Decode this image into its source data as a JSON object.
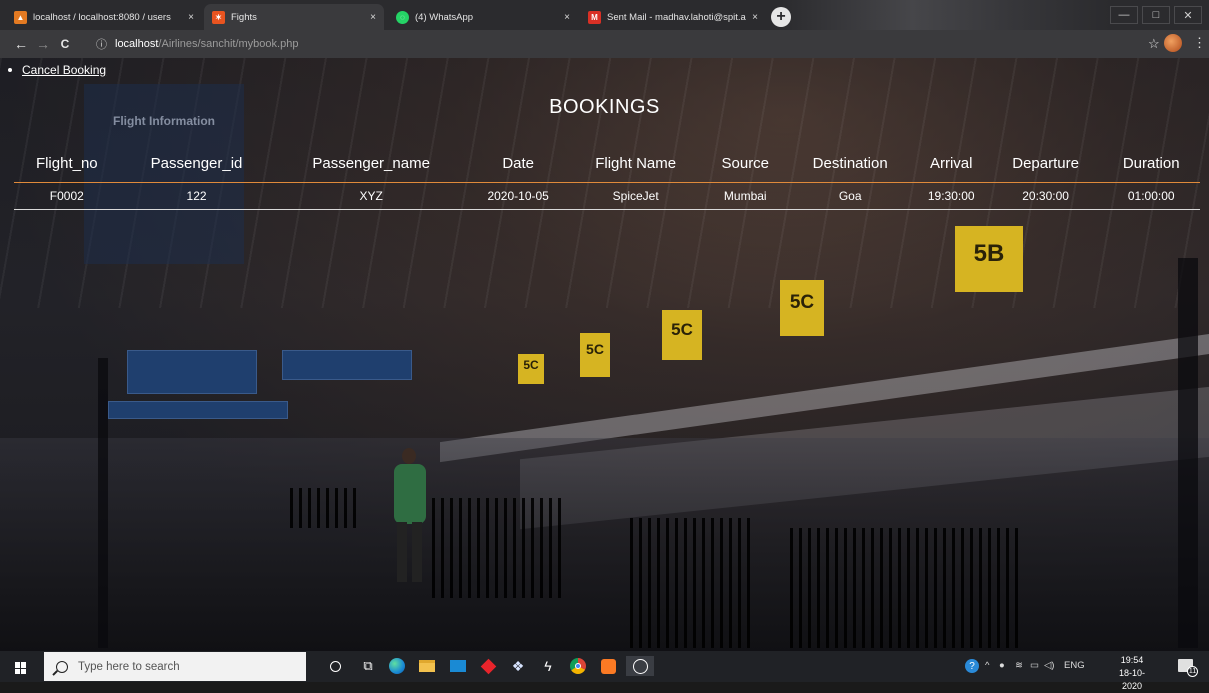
{
  "browser": {
    "tabs": [
      {
        "title": "localhost / localhost:8080 / users",
        "favicon_color": "#e37a22",
        "active": false
      },
      {
        "title": "Fights",
        "favicon_color": "#e95420",
        "active": true
      },
      {
        "title": "(4) WhatsApp",
        "favicon_color": "#25d366",
        "active": false
      },
      {
        "title": "Sent Mail - madhav.lahoti@spit.ac",
        "favicon_color": "#d93025",
        "active": false
      }
    ],
    "new_tab_symbol": "+",
    "url_host": "localhost",
    "url_path": "/Airlines/sanchit/mybook.php",
    "back_symbol": "←",
    "forward_symbol": "→",
    "reload_symbol": "C",
    "info_symbol": "ⓘ",
    "close_symbol": "×",
    "star_symbol": "☆",
    "menu_symbol": "⋮",
    "minimize_symbol": "—",
    "maximize_symbol": "□",
    "window_close_symbol": "✕"
  },
  "page": {
    "cancel_link": "Cancel Booking",
    "heading": "BOOKINGS",
    "table": {
      "headers": [
        "Flight_no",
        "Passenger_id",
        "Passenger_name",
        "Date",
        "Flight Name",
        "Source",
        "Destination",
        "Arrival",
        "Departure",
        "Duration"
      ],
      "rows": [
        [
          "F0002",
          "122",
          "XYZ",
          "2020-10-05",
          "SpiceJet",
          "Mumbai",
          "Goa",
          "19:30:00",
          "20:30:00",
          "01:00:00"
        ]
      ]
    },
    "background": {
      "signs": [
        "5B",
        "5C",
        "5C",
        "5C",
        "5C"
      ],
      "info_board": "Flight Information"
    }
  },
  "taskbar": {
    "search_placeholder": "Type here to search",
    "language": "ENG",
    "time": "19:54",
    "date": "18-10-2020",
    "notification_count": "11",
    "icons": [
      "task-view-icon",
      "edge-icon",
      "file-explorer-icon",
      "mail-icon",
      "app-red-icon",
      "dropbox-icon",
      "app-bolt-icon",
      "chrome-icon",
      "xampp-icon",
      "whatsapp-icon"
    ]
  }
}
